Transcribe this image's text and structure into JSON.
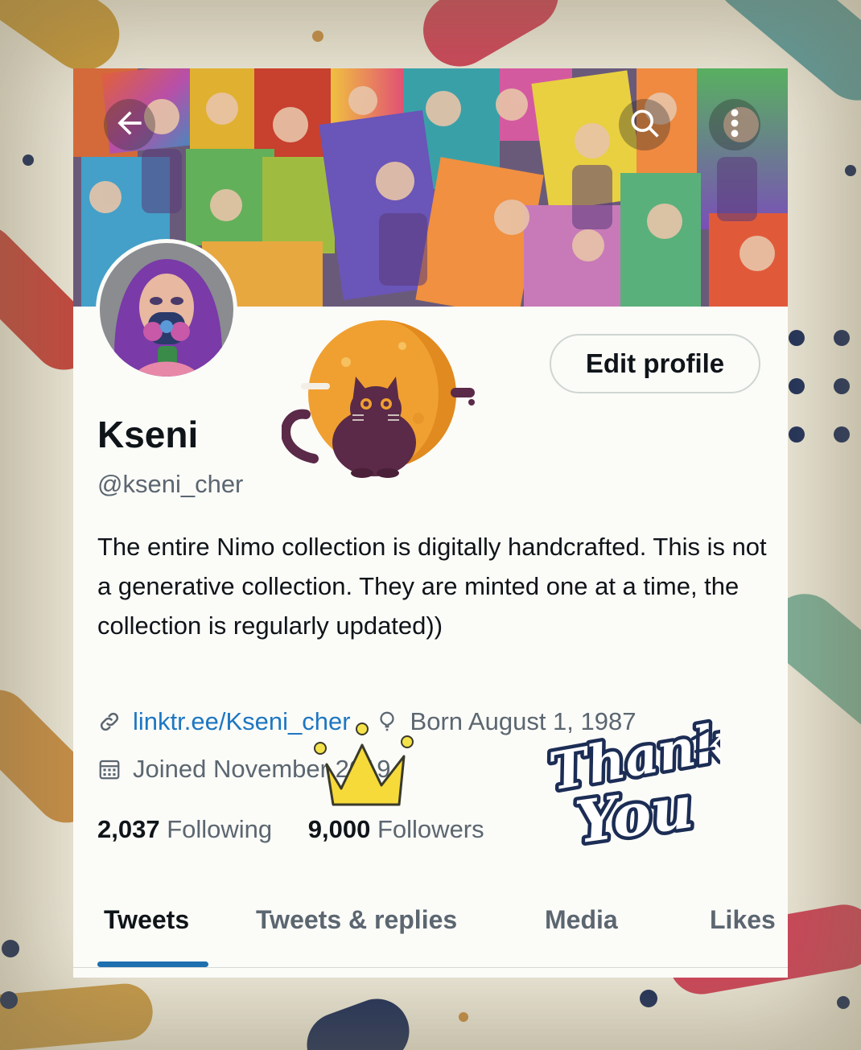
{
  "profile": {
    "display_name": "Kseni",
    "handle": "@kseni_cher",
    "bio": "The entire Nimo collection is digitally handcrafted. This is not a generative collection.  They are minted one at a time, the collection is regularly updated))",
    "link_text": "linktr.ee/Kseni_cher",
    "born_text": "Born August 1, 1987",
    "joined_text": "Joined November 2019",
    "following_count": "2,037",
    "following_label": "Following",
    "followers_count": "9,000",
    "followers_label": "Followers"
  },
  "actions": {
    "edit_profile_label": "Edit profile"
  },
  "tabs": [
    {
      "label": "Tweets",
      "active": true
    },
    {
      "label": "Tweets & replies",
      "active": false
    },
    {
      "label": "Media",
      "active": false
    },
    {
      "label": "Likes",
      "active": false
    }
  ],
  "header_icons": [
    "back-arrow-icon",
    "search-icon",
    "more-options-icon"
  ],
  "stickers": {
    "thank_you_line1": "Thank",
    "thank_you_line2": "You"
  },
  "colors": {
    "accent": "#1d6fb0",
    "link": "#1d77c2",
    "text_primary": "#0f1419",
    "text_secondary": "#5b6670"
  }
}
